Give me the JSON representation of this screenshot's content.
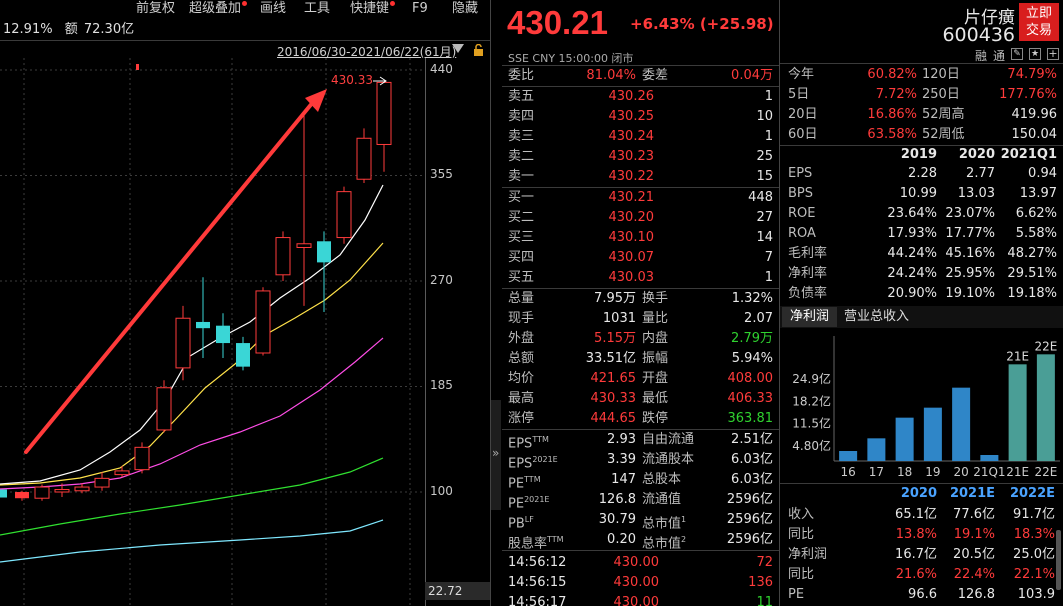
{
  "toolbar": {
    "items": [
      "前复权",
      "超级叠加",
      "画线",
      "工具",
      "快捷键",
      "F9",
      "隐藏"
    ],
    "info_change": "12.91%",
    "info_amount_label": "额",
    "info_amount": "72.30亿"
  },
  "chart": {
    "range": "2016/06/30-2021/06/22(61月)",
    "y_ticks": [
      "440",
      "355",
      "270",
      "185",
      "100"
    ],
    "bottom_value": "22.72",
    "high_label": "430.33",
    "colors": {
      "up": "#ff3b3b",
      "down": "#3ad6d6",
      "ma5": "#ffffff",
      "ma10": "#ffe24a",
      "ma20": "#ff4de6",
      "ma30": "#30e030",
      "ma60": "#7fe8ff",
      "arrow": "#ff3a3a"
    }
  },
  "quote": {
    "price": "430.21",
    "change": "+6.43% (+25.98)",
    "name": "片仔癀",
    "code": "600436",
    "exchange_line": "SSE CNY 15:00:00 闭市",
    "badges": [
      "融",
      "通"
    ],
    "buy_button": [
      "立即",
      "交易"
    ]
  },
  "order_book": {
    "ratio": {
      "label": "委比",
      "value": "81.04%",
      "label2": "委差",
      "value2": "0.04万"
    },
    "sells": [
      {
        "label": "卖五",
        "price": "430.26",
        "vol": "1"
      },
      {
        "label": "卖四",
        "price": "430.25",
        "vol": "10"
      },
      {
        "label": "卖三",
        "price": "430.24",
        "vol": "1"
      },
      {
        "label": "卖二",
        "price": "430.23",
        "vol": "25"
      },
      {
        "label": "卖一",
        "price": "430.22",
        "vol": "15"
      }
    ],
    "buys": [
      {
        "label": "买一",
        "price": "430.21",
        "vol": "448"
      },
      {
        "label": "买二",
        "price": "430.20",
        "vol": "27"
      },
      {
        "label": "买三",
        "price": "430.10",
        "vol": "14"
      },
      {
        "label": "买四",
        "price": "430.07",
        "vol": "7"
      },
      {
        "label": "买五",
        "price": "430.03",
        "vol": "1"
      }
    ]
  },
  "stats": [
    {
      "l1": "总量",
      "v1": "7.95万",
      "c1": "white",
      "l2": "换手",
      "v2": "1.32%",
      "c2": "white"
    },
    {
      "l1": "现手",
      "v1": "1031",
      "c1": "white",
      "l2": "量比",
      "v2": "2.07",
      "c2": "white"
    },
    {
      "l1": "外盘",
      "v1": "5.15万",
      "c1": "red",
      "l2": "内盘",
      "v2": "2.79万",
      "c2": "green"
    },
    {
      "l1": "总额",
      "v1": "33.51亿",
      "c1": "white",
      "l2": "振幅",
      "v2": "5.94%",
      "c2": "white"
    },
    {
      "l1": "均价",
      "v1": "421.65",
      "c1": "red",
      "l2": "开盘",
      "v2": "408.00",
      "c2": "red"
    },
    {
      "l1": "最高",
      "v1": "430.33",
      "c1": "red",
      "l2": "最低",
      "v2": "406.33",
      "c2": "red"
    },
    {
      "l1": "涨停",
      "v1": "444.65",
      "c1": "red",
      "l2": "跌停",
      "v2": "363.81",
      "c2": "green"
    }
  ],
  "fundamentals": [
    {
      "l1": "EPS",
      "s1": "TTM",
      "v1": "2.93",
      "l2": "自由流通",
      "s2": "",
      "v2": "2.51亿"
    },
    {
      "l1": "EPS",
      "s1": "2021E",
      "v1": "3.39",
      "l2": "流通股本",
      "s2": "",
      "v2": "6.03亿"
    },
    {
      "l1": "PE",
      "s1": "TTM",
      "v1": "147",
      "l2": "总股本",
      "s2": "",
      "v2": "6.03亿"
    },
    {
      "l1": "PE",
      "s1": "2021E",
      "v1": "126.8",
      "l2": "流通值",
      "s2": "",
      "v2": "2596亿"
    },
    {
      "l1": "PB",
      "s1": "LF",
      "v1": "30.79",
      "l2": "总市值",
      "s2": "1",
      "v2": "2596亿"
    },
    {
      "l1": "股息率",
      "s1": "TTM",
      "v1": "0.20",
      "l2": "总市值",
      "s2": "2",
      "v2": "2596亿"
    }
  ],
  "ticks": [
    {
      "time": "14:56:12",
      "price": "430.00",
      "vol": "72",
      "c": "red"
    },
    {
      "time": "14:56:15",
      "price": "430.00",
      "vol": "136",
      "c": "red"
    },
    {
      "time": "14:56:17",
      "price": "430.00",
      "vol": "11",
      "c": "green"
    }
  ],
  "performance": [
    {
      "l1": "今年",
      "v1": "60.82%",
      "l2": "120日",
      "v2": "74.79%"
    },
    {
      "l1": "5日",
      "v1": "7.72%",
      "l2": "250日",
      "v2": "177.76%"
    },
    {
      "l1": "20日",
      "v1": "16.86%",
      "l2": "52周高",
      "v2": "419.96"
    },
    {
      "l1": "60日",
      "v1": "63.58%",
      "l2": "52周低",
      "v2": "150.04"
    }
  ],
  "fin_table": {
    "headers": [
      "2019",
      "2020",
      "2021Q1"
    ],
    "rows": [
      {
        "label": "EPS",
        "vals": [
          "2.28",
          "2.77",
          "0.94"
        ]
      },
      {
        "label": "BPS",
        "vals": [
          "10.99",
          "13.03",
          "13.97"
        ]
      },
      {
        "label": "ROE",
        "vals": [
          "23.64%",
          "23.07%",
          "6.62%"
        ]
      },
      {
        "label": "ROA",
        "vals": [
          "17.93%",
          "17.77%",
          "5.58%"
        ]
      },
      {
        "label": "毛利率",
        "vals": [
          "44.24%",
          "45.16%",
          "48.27%"
        ]
      },
      {
        "label": "净利率",
        "vals": [
          "24.24%",
          "25.95%",
          "29.51%"
        ]
      },
      {
        "label": "负债率",
        "vals": [
          "20.90%",
          "19.10%",
          "19.18%"
        ]
      }
    ]
  },
  "profit_tabs": [
    "净利润",
    "营业总收入"
  ],
  "chart_data": {
    "type": "bar",
    "categories": [
      "16",
      "17",
      "18",
      "19",
      "20",
      "21Q1",
      "21E",
      "22E"
    ],
    "values": [
      3.0,
      6.8,
      13.0,
      16.0,
      22.0,
      1.8,
      29.0,
      32.0
    ],
    "estimate_flags": [
      false,
      false,
      false,
      false,
      false,
      false,
      true,
      true
    ],
    "y_ticks": [
      "24.9亿",
      "18.2亿",
      "11.5亿",
      "4.80亿"
    ],
    "ylim": [
      0,
      37.5
    ],
    "bar_labels": [
      "",
      "",
      "",
      "",
      "",
      "",
      "21E",
      "22E"
    ]
  },
  "forecast": {
    "headers": [
      "2020",
      "2021E",
      "2022E"
    ],
    "rows": [
      {
        "label": "收入",
        "vals": [
          "65.1亿",
          "77.6亿",
          "91.7亿"
        ],
        "c": "white"
      },
      {
        "label": "同比",
        "vals": [
          "13.8%",
          "19.1%",
          "18.3%"
        ],
        "c": "red"
      },
      {
        "label": "净利润",
        "vals": [
          "16.7亿",
          "20.5亿",
          "25.0亿"
        ],
        "c": "white"
      },
      {
        "label": "同比",
        "vals": [
          "21.6%",
          "22.4%",
          "22.1%"
        ],
        "c": "red"
      },
      {
        "label": "PE",
        "vals": [
          "96.6",
          "126.8",
          "103.9"
        ],
        "c": "white"
      }
    ]
  }
}
